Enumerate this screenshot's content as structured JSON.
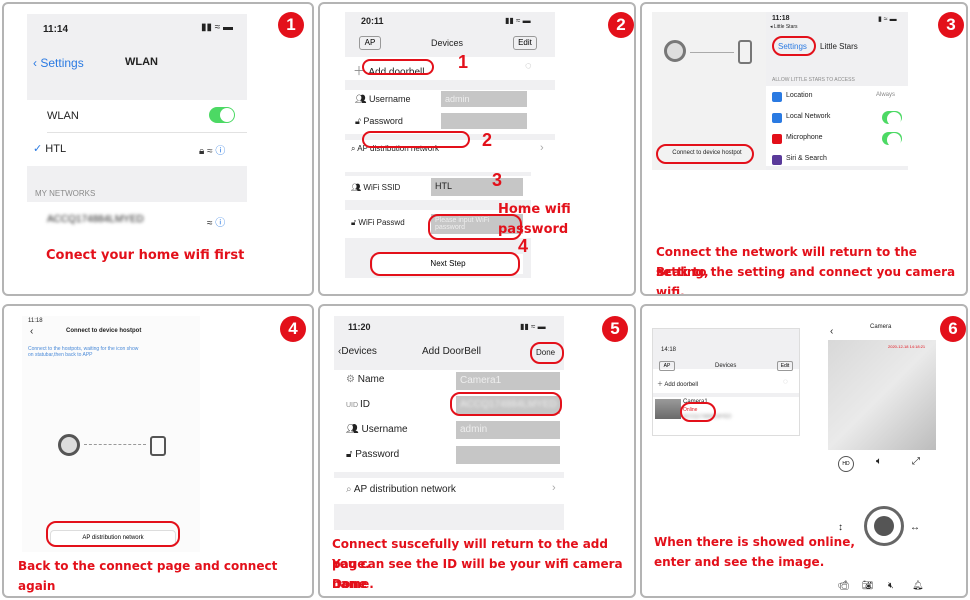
{
  "panel1": {
    "time": "11:14",
    "back": "Settings",
    "title": "WLAN",
    "wlan": "WLAN",
    "network": "HTL",
    "section": "MY NETWORKS",
    "other": "ACCQ174884LMYED",
    "caption": "Conect your home wifi first"
  },
  "panel2": {
    "time": "20:11",
    "ap": "AP",
    "title": "Devices",
    "edit": "Edit",
    "add": "Add doorbell",
    "username": "Username",
    "username_value": "admin",
    "password": "Password",
    "ap_network": "AP distribution network",
    "ssid_label": "WiFi SSID",
    "ssid_value": "HTL",
    "passwd_label": "WiFi Passwd",
    "passwd_placeholder": "Please input WiFi password",
    "next": "Next Step",
    "n1": "1",
    "n2": "2",
    "n3": "3",
    "n4": "4",
    "home_pw": "Home wifi password"
  },
  "panel3": {
    "time": "11:18",
    "app_back": "◂ Little Stars",
    "settings": "Settings",
    "app": "Little Stars",
    "section": "ALLOW LITTLE STARS TO ACCESS",
    "location": "Location",
    "location_value": "Always",
    "local": "Local Network",
    "mic": "Microphone",
    "siri": "Siri & Search",
    "connect": "Connect to device hostpot",
    "caption1": "Connect the network will return to the setting,",
    "caption2": "Bcak to the setting and connect you camera wifi."
  },
  "panel4": {
    "time": "11:18",
    "title": "Connect to device hostpot",
    "desc1": "Connect to the hostpots,   waiting for the icon show",
    "desc2": "on statubar,then back to APP",
    "ap_button": "AP distribution network",
    "caption": "Back to the connect page and connect again"
  },
  "panel5": {
    "time": "11:20",
    "back": "Devices",
    "title": "Add DoorBell",
    "done": "Done",
    "name": "Name",
    "name_value": "Camera1",
    "id": "ID",
    "id_value": "ACCQ174884LMYED",
    "username": "Username",
    "username_value": "admin",
    "password": "Password",
    "ap_network": "AP distribution network",
    "caption1": "Connect suscefully will return to the add page.",
    "caption2": "You can see the  ID will be your wifi camera name.",
    "caption3": "Done"
  },
  "panel6": {
    "time": "14:18",
    "ap": "AP",
    "title": "Devices",
    "edit": "Edit",
    "add": "Add doorbell",
    "cam_name": "Camera1",
    "online": "Online",
    "cam_id": "ACCQ174884LMYED",
    "cam_title": "Camera",
    "timestamp": "2020-12-18 14:18:21",
    "hd": "HD",
    "caption1": "When there is showed online,",
    "caption2": "enter and see the image."
  },
  "numbers": [
    "1",
    "2",
    "3",
    "4",
    "5",
    "6"
  ]
}
